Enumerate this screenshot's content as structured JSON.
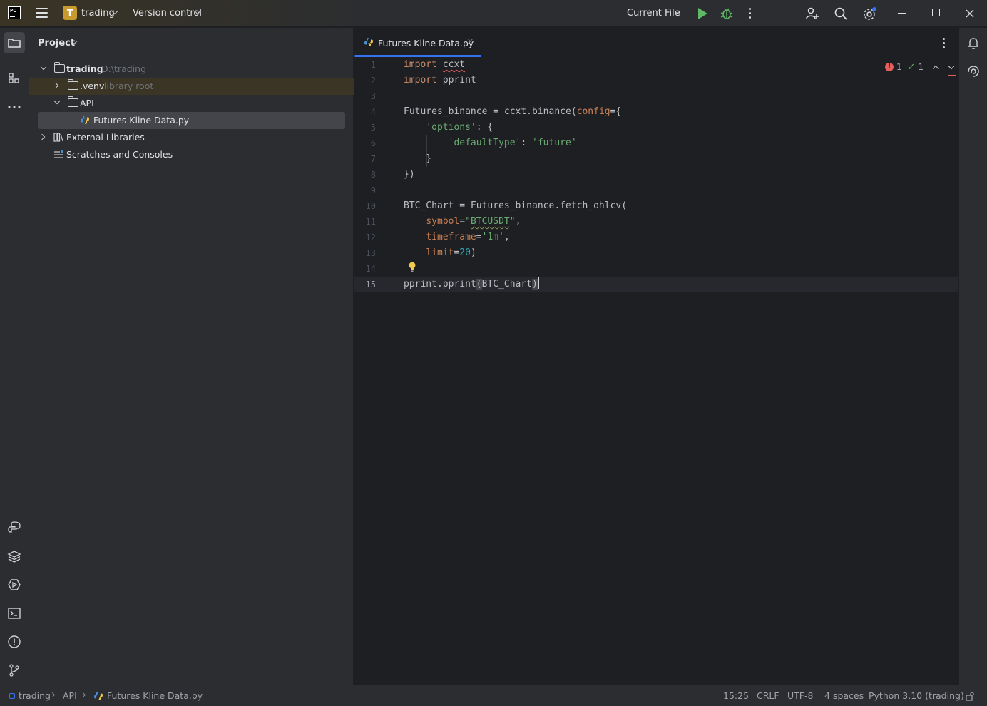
{
  "titlebar": {
    "project_badge": "T",
    "project_name": "trading",
    "vcs_label": "Version control",
    "run_config": "Current File"
  },
  "project_panel": {
    "title": "Project",
    "tree": [
      {
        "label": "trading",
        "hint": "D:\\trading"
      },
      {
        "label": ".venv",
        "hint": "library root"
      },
      {
        "label": "API"
      },
      {
        "label": "Futures Kline Data.py"
      },
      {
        "label": "External Libraries"
      },
      {
        "label": "Scratches and Consoles"
      }
    ]
  },
  "editor": {
    "tab_label": "Futures Kline Data.py",
    "tab_close": "×",
    "inspections": {
      "errors": "1",
      "warnings": "1"
    },
    "line_numbers": [
      "1",
      "2",
      "3",
      "4",
      "5",
      "6",
      "7",
      "8",
      "9",
      "10",
      "11",
      "12",
      "13",
      "14",
      "15"
    ]
  },
  "statusbar": {
    "breadcrumbs": [
      "trading",
      "API",
      "Futures Kline Data.py"
    ],
    "position": "15:25",
    "line_sep": "CRLF",
    "encoding": "UTF-8",
    "indent": "4 spaces",
    "interpreter": "Python 3.10 (trading)"
  },
  "icons": {
    "app": "pycharm-logo-icon",
    "menu": "hamburger-icon",
    "run": "run-icon",
    "debug": "debug-icon",
    "more": "more-vertical-icon",
    "add_user": "add-user-icon",
    "search": "search-icon",
    "settings": "gear-icon",
    "notifications": "bell-icon",
    "ai": "ai-assistant-icon"
  },
  "colors": {
    "accent": "#3574f0",
    "run": "#5fb865",
    "error": "#e55f5f",
    "keyword": "#cf8e6d",
    "string": "#6aab73",
    "number": "#2aacb8"
  }
}
